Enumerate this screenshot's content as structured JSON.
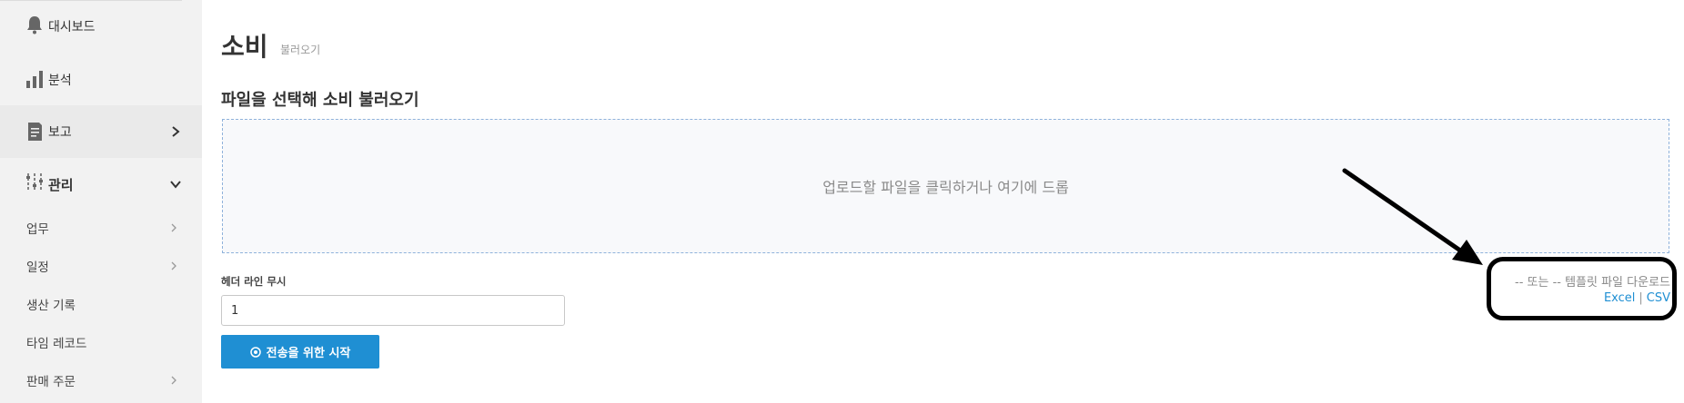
{
  "sidebar": {
    "dashboard": {
      "label": "대시보드",
      "icon": "bell-icon"
    },
    "analysis": {
      "label": "분석",
      "icon": "bar-chart-icon"
    },
    "report": {
      "label": "보고",
      "icon": "document-icon"
    },
    "manage": {
      "label": "관리",
      "icon": "sliders-icon"
    },
    "sub_items": [
      {
        "label": "업무",
        "has_chevron": true
      },
      {
        "label": "일정",
        "has_chevron": true
      },
      {
        "label": "생산 기록",
        "has_chevron": false
      },
      {
        "label": "타임 레코드",
        "has_chevron": false
      },
      {
        "label": "판매 주문",
        "has_chevron": true
      }
    ]
  },
  "header": {
    "title": "소비",
    "subtitle": "불러오기"
  },
  "section": {
    "title": "파일을 선택해 소비 불러오기"
  },
  "dropzone": {
    "text": "업로드할 파일을 클릭하거나 여기에 드롭"
  },
  "form": {
    "header_lines_label": "헤더 라인 무시",
    "header_lines_value": "1",
    "submit_label": "전송을 위한 시작"
  },
  "template": {
    "text": "-- 또는 -- 템플릿 파일 다운로드",
    "excel_label": "Excel",
    "separator": "|",
    "csv_label": "CSV"
  },
  "colors": {
    "accent": "#1f8fd3",
    "sidebar_bg": "#f2f2f2",
    "annotation": "#000000"
  }
}
